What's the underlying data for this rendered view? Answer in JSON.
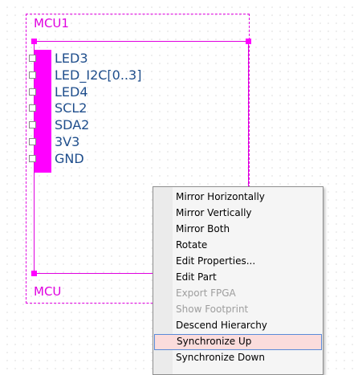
{
  "component": {
    "title": "MCU1",
    "label": "MCU",
    "pins": [
      "LED3",
      "LED_I2C[0..3]",
      "LED4",
      "SCL2",
      "SDA2",
      "3V3",
      "GND"
    ],
    "color": "#ff00ff",
    "pin_text_color": "#1f4e8c"
  },
  "context_menu": {
    "items": [
      {
        "label": "Mirror Horizontally",
        "enabled": true
      },
      {
        "label": "Mirror Vertically",
        "enabled": true
      },
      {
        "label": "Mirror Both",
        "enabled": true
      },
      {
        "label": "Rotate",
        "enabled": true
      },
      {
        "label": "Edit Properties...",
        "enabled": true
      },
      {
        "label": "Edit Part",
        "enabled": true
      },
      {
        "label": "Export FPGA",
        "enabled": false
      },
      {
        "label": "Show Footprint",
        "enabled": false
      },
      {
        "label": "Descend Hierarchy",
        "enabled": true
      },
      {
        "label": "Synchronize Up",
        "enabled": true,
        "highlighted": true
      },
      {
        "label": "Synchronize Down",
        "enabled": true
      }
    ],
    "highlight_color": "#fbdcdc"
  }
}
